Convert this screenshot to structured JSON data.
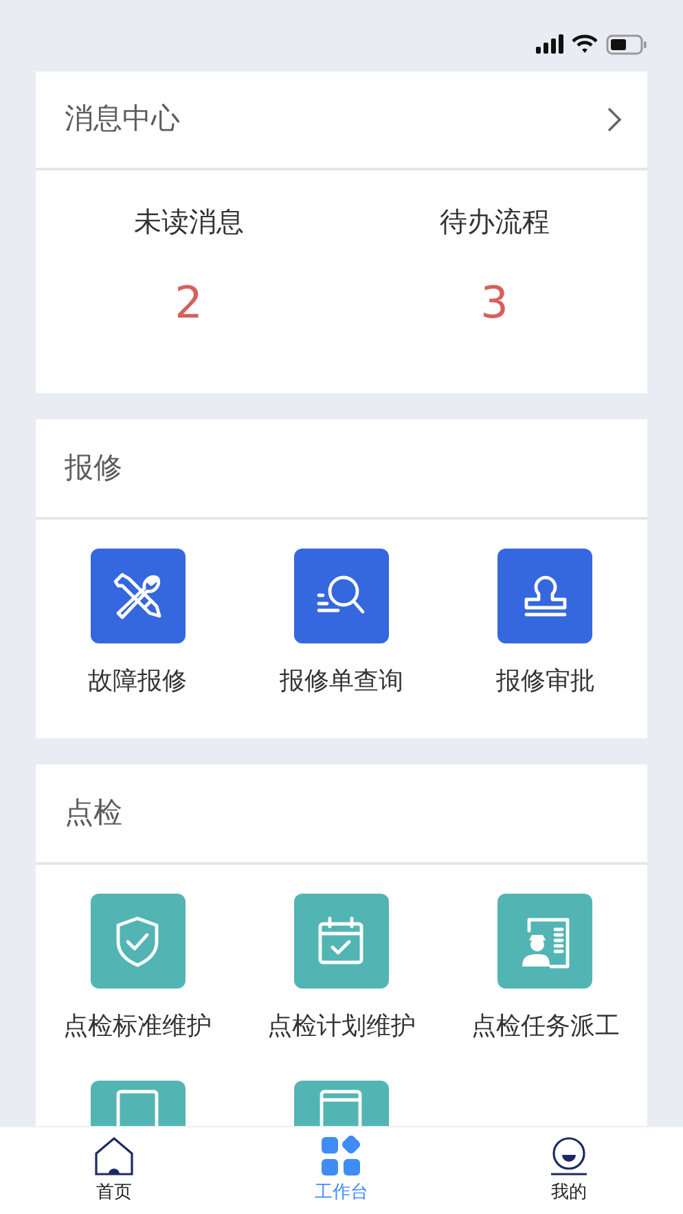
{
  "message_center": {
    "title": "消息中心",
    "stats": [
      {
        "label": "未读消息",
        "count": "2"
      },
      {
        "label": "待办流程",
        "count": "3"
      }
    ]
  },
  "sections": [
    {
      "title": "报修",
      "color": "#3567de",
      "items": [
        {
          "kind": "app",
          "label": "故障报修"
        },
        {
          "kind": "app",
          "label": "报修单查询"
        },
        {
          "kind": "app",
          "label": "报修审批"
        }
      ]
    },
    {
      "title": "点检",
      "color": "#52b5b3",
      "items": [
        {
          "kind": "app",
          "label": "点检标准维护"
        },
        {
          "kind": "app",
          "label": "点检计划维护"
        },
        {
          "kind": "app",
          "label": "点检任务派工"
        },
        {
          "kind": "partial"
        },
        {
          "kind": "partial"
        }
      ]
    }
  ],
  "tab_bar": [
    {
      "label": "首页",
      "selected": false
    },
    {
      "label": "工作台",
      "selected": true
    },
    {
      "label": "我的",
      "selected": false
    }
  ]
}
